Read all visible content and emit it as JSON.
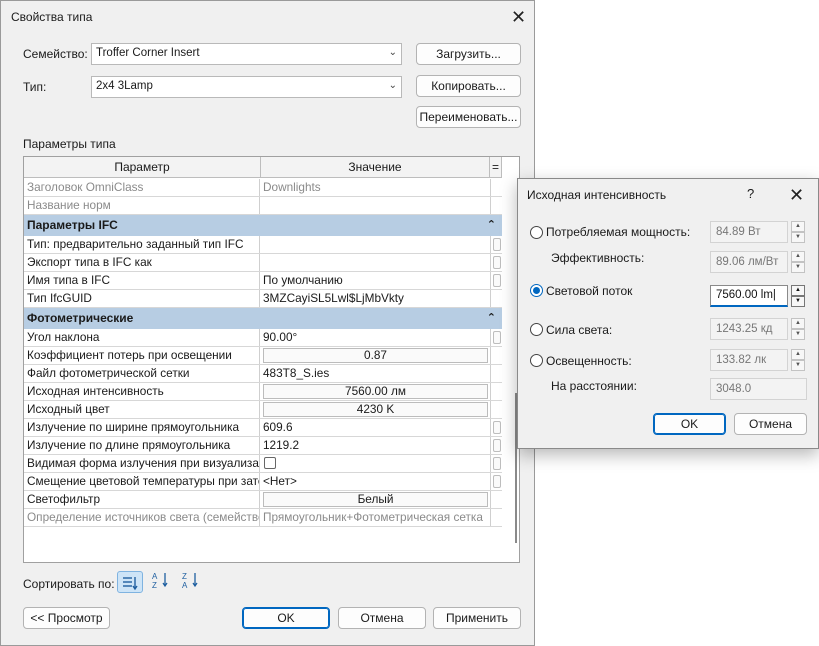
{
  "main": {
    "title": "Свойства типа",
    "family_label": "Семейство:",
    "family_value": "Troffer Corner Insert",
    "type_label": "Тип:",
    "type_value": "2x4 3Lamp",
    "load_button": "Загрузить...",
    "copy_button": "Копировать...",
    "rename_button": "Переименовать...",
    "section_label": "Параметры типа",
    "grid": {
      "col_param": "Параметр",
      "col_value": "Значение",
      "col_menu": "=",
      "rows": [
        {
          "kind": "row",
          "name": "Заголовок OmniClass",
          "value": "Downlights",
          "gray": true
        },
        {
          "kind": "row",
          "name": "Название норм",
          "value": "",
          "gray": true
        },
        {
          "kind": "group",
          "name": "Параметры IFC"
        },
        {
          "kind": "row",
          "name": "Тип: предварительно заданный тип IFC",
          "value": "",
          "stub": true
        },
        {
          "kind": "row",
          "name": "Экспорт типа в IFC как",
          "value": "",
          "stub": true
        },
        {
          "kind": "row",
          "name": "Имя типа в IFC",
          "value": "По умолчанию",
          "stub": true
        },
        {
          "kind": "row",
          "name": "Тип IfcGUID",
          "value": "3MZCayiSL5Lwl$LjMbVkty"
        },
        {
          "kind": "group",
          "name": "Фотометрические"
        },
        {
          "kind": "row",
          "name": "Угол наклона",
          "value": "90.00°",
          "stub": true
        },
        {
          "kind": "row",
          "name": "Коэффициент потерь при освещении",
          "value": "0.87",
          "button": true
        },
        {
          "kind": "row",
          "name": "Файл фотометрической сетки",
          "value": "483T8_S.ies"
        },
        {
          "kind": "row",
          "name": "Исходная интенсивность",
          "value": "7560.00 лм",
          "button": true
        },
        {
          "kind": "row",
          "name": "Исходный цвет",
          "value": "4230 K",
          "button": true
        },
        {
          "kind": "row",
          "name": "Излучение по ширине прямоугольника",
          "value": "609.6",
          "stub": true
        },
        {
          "kind": "row",
          "name": "Излучение по длине прямоугольника",
          "value": "1219.2",
          "stub": true
        },
        {
          "kind": "row",
          "name": "Видимая форма излучения при визуализации",
          "value": "",
          "checkbox": true,
          "stub": true
        },
        {
          "kind": "row",
          "name": "Смещение цветовой температуры при затемнении",
          "value": "<Нет>",
          "stub": true
        },
        {
          "kind": "row",
          "name": "Светофильтр",
          "value": "Белый",
          "button": true
        },
        {
          "kind": "row",
          "name": "Определение источников света (семейство)",
          "value": "Прямоугольник+Фотометрическая сетка",
          "gray": true
        }
      ]
    },
    "sort_label": "Сортировать по:",
    "preview_button": "<< Просмотр",
    "ok_button": "OK",
    "cancel_button": "Отмена",
    "apply_button": "Применить"
  },
  "popup": {
    "title": "Исходная интенсивность",
    "help": "?",
    "power_label": "Потребляемая мощность:",
    "power_value": "84.89 Вт",
    "efficacy_label": "Эффективность:",
    "efficacy_value": "89.06 лм/Вт",
    "flux_label": "Световой поток",
    "flux_value": "7560.00 lm",
    "intensity_label": "Сила света:",
    "intensity_value": "1243.25 кд",
    "illuminance_label": "Освещенность:",
    "illuminance_value": "133.82 лк",
    "distance_label": "На расстоянии:",
    "distance_value": "3048.0",
    "ok_button": "OK",
    "cancel_button": "Отмена",
    "selected_option": "Световой поток"
  },
  "colors": {
    "group_header": "#b7cde3",
    "accent": "#0067c0",
    "dialog_bg": "#f0f0f0"
  }
}
